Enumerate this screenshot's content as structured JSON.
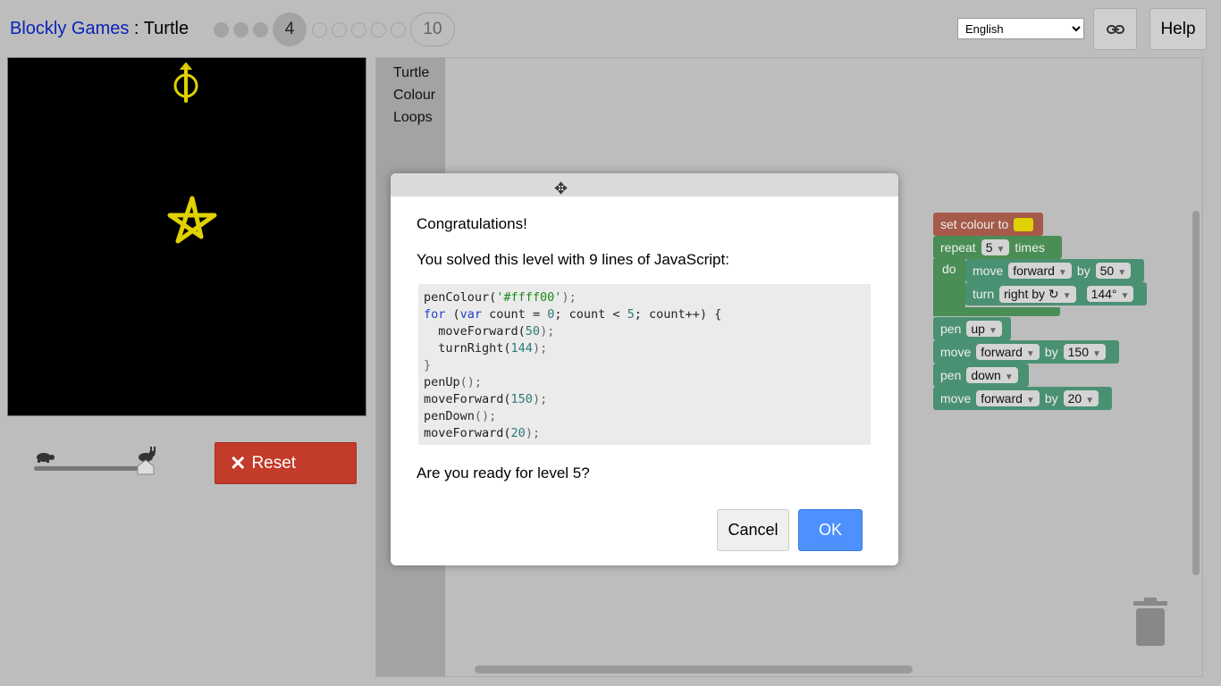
{
  "header": {
    "app_name": "Blockly Games",
    "separator": " : ",
    "game_name": "Turtle",
    "levels": {
      "current_label": "4",
      "last_label": "10"
    },
    "language_selected": "English",
    "help_label": "Help"
  },
  "controls": {
    "reset_label": "Reset",
    "reset_icon": "✕"
  },
  "toolbox": {
    "categories": [
      "Turtle",
      "Colour",
      "Loops"
    ]
  },
  "blocks": {
    "set_colour": "set colour to",
    "repeat": "repeat",
    "repeat_count": "5",
    "times": "times",
    "do": "do",
    "move": "move",
    "forward": "forward",
    "by": "by",
    "move1_value": "50",
    "turn": "turn",
    "turn_dir": "right by ↻",
    "turn_value": "144°",
    "pen": "pen",
    "pen_up": "up",
    "move2_value": "150",
    "pen_down": "down",
    "move3_value": "20"
  },
  "dialog": {
    "move_icon": "✥",
    "heading": "Congratulations!",
    "solved_text": "You solved this level with 9 lines of JavaScript:",
    "code": {
      "l1a": "penColour(",
      "l1s": "'#ffff00'",
      "l1b": ");",
      "l2kw1": "for",
      "l2a": " (",
      "l2kw2": "var",
      "l2b": " count = ",
      "l2n1": "0",
      "l2c": "; count < ",
      "l2n2": "5",
      "l2d": "; count++) {",
      "l3a": "  moveForward(",
      "l3n": "50",
      "l3b": ");",
      "l4a": "  turnRight(",
      "l4n": "144",
      "l4b": ");",
      "l5": "}",
      "l6a": "penUp",
      "l6b": "();",
      "l7a": "moveForward(",
      "l7n": "150",
      "l7b": ");",
      "l8a": "penDown",
      "l8b": "();",
      "l9a": "moveForward(",
      "l9n": "20",
      "l9b": ");"
    },
    "ready_text": "Are you ready for level 5?",
    "cancel_label": "Cancel",
    "ok_label": "OK"
  },
  "colors": {
    "accent_blue": "#4d90fe",
    "reset_red": "#c33b2a",
    "turtle_yellow": "#e0d200"
  }
}
